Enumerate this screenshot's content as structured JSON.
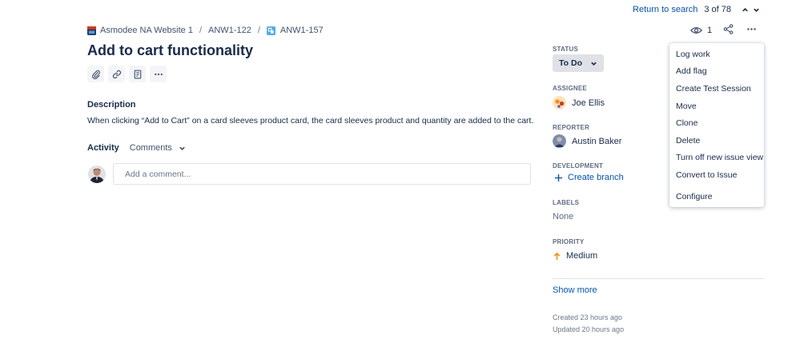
{
  "nav": {
    "return_to_search": "Return to search",
    "position": "3 of 78"
  },
  "breadcrumb": {
    "project": "Asmodee NA Website 1",
    "parent": "ANW1-122",
    "issue": "ANW1-157"
  },
  "issue": {
    "title": "Add to cart functionality",
    "description_label": "Description",
    "description": "When clicking “Add to Cart” on a card sleeves product card, the card sleeves product and quantity are added to the cart."
  },
  "activity": {
    "label": "Activity",
    "filter": "Comments",
    "comment_placeholder": "Add a comment..."
  },
  "watch": {
    "count": "1"
  },
  "sidebar": {
    "status_label": "STATUS",
    "status_value": "To Do",
    "assignee_label": "ASSIGNEE",
    "assignee": "Joe Ellis",
    "reporter_label": "REPORTER",
    "reporter": "Austin Baker",
    "development_label": "DEVELOPMENT",
    "create_branch": "Create branch",
    "labels_label": "LABELS",
    "labels_value": "None",
    "priority_label": "PRIORITY",
    "priority_value": "Medium",
    "show_more": "Show more",
    "created": "Created 23 hours ago",
    "updated": "Updated 20 hours ago"
  },
  "menu": {
    "items": [
      "Log work",
      "Add flag",
      "Create Test Session",
      "Move",
      "Clone",
      "Delete",
      "Turn off new issue view",
      "Convert to Issue",
      "Configure"
    ]
  },
  "colors": {
    "link": "#0052cc",
    "text": "#172b4d",
    "subtle": "#5e6c84",
    "status_bg": "#dfe1e6",
    "priority_medium": "#ff8b00",
    "story_icon": "#4bade8"
  },
  "icons": {
    "up": "chevron-up-icon",
    "down": "chevron-down-icon",
    "attach": "paperclip-icon",
    "link": "link-icon",
    "page": "confluence-page-icon",
    "more": "more-horizontal-icon",
    "watch": "eye-icon",
    "share": "share-icon",
    "plus": "plus-icon",
    "priority": "arrow-up-icon"
  }
}
